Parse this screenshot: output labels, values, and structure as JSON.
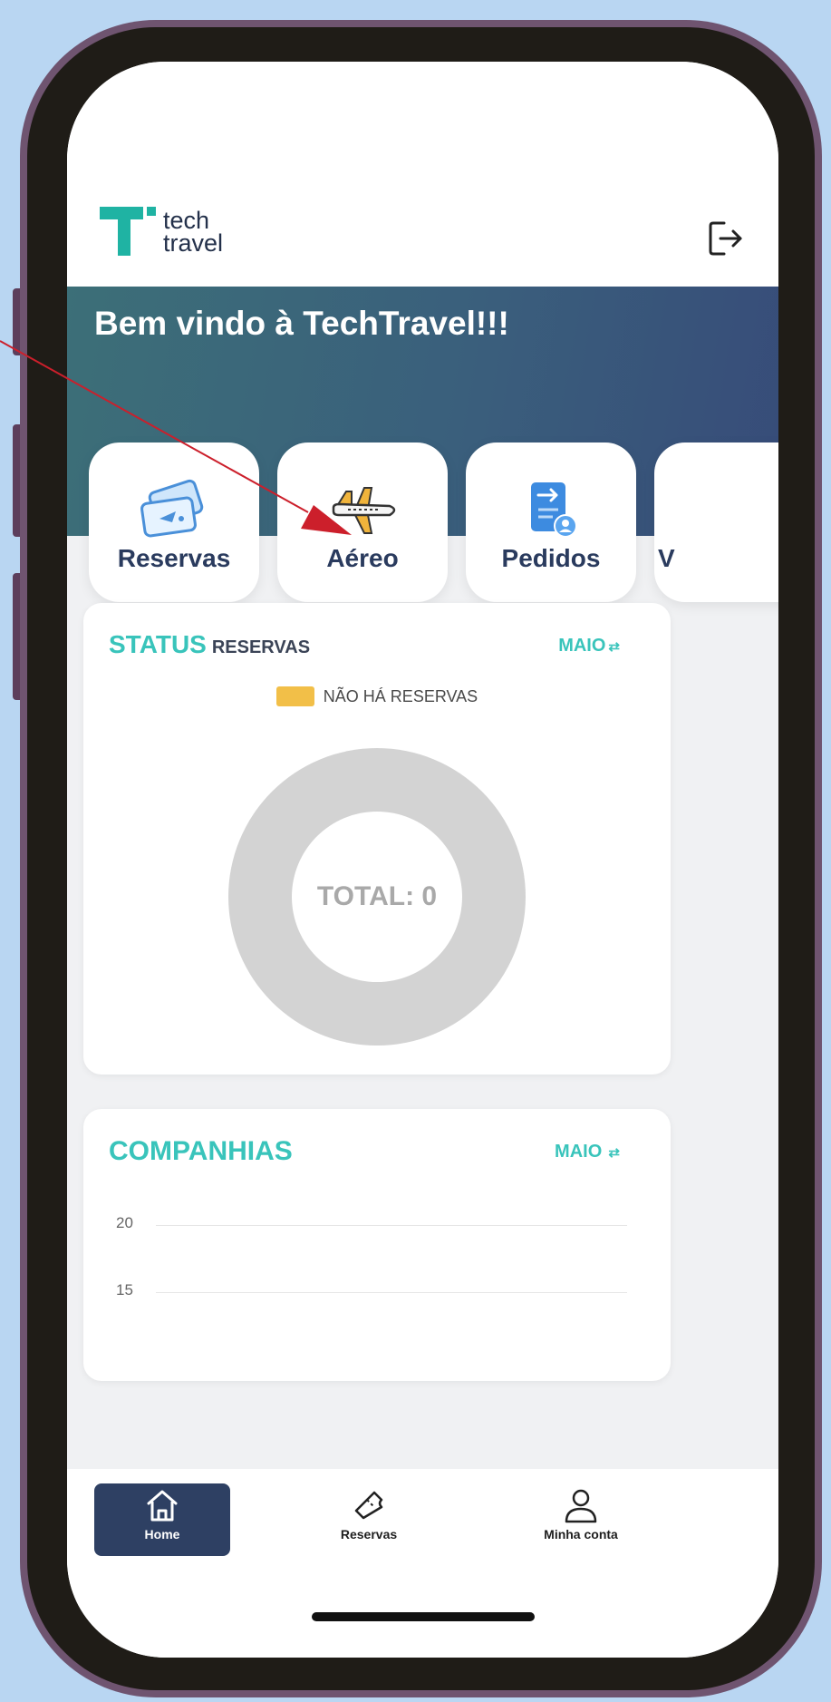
{
  "app": {
    "logo_line1": "tech",
    "logo_line2": "travel",
    "welcome": "Bem vindo à TechTravel!!!"
  },
  "categories": [
    {
      "label": "Reservas",
      "icon": "tickets-icon"
    },
    {
      "label": "Aéreo",
      "icon": "airplane-icon"
    },
    {
      "label": "Pedidos",
      "icon": "document-user-icon"
    },
    {
      "label": "V",
      "icon": ""
    }
  ],
  "status_panel": {
    "title_highlight": "STATUS",
    "title_rest": "RESERVAS",
    "month": "MAIO",
    "legend_label": "NÃO HÁ RESERVAS",
    "legend_color": "#f2bf48",
    "total_label": "TOTAL: 0"
  },
  "companies_panel": {
    "title": "COMPANHIAS",
    "month": "MAIO",
    "y_ticks": [
      "20",
      "15"
    ]
  },
  "bottom_nav": {
    "home": "Home",
    "reservations": "Reservas",
    "account": "Minha conta"
  },
  "colors": {
    "teal": "#39c4bb",
    "navy": "#2e4063",
    "annotation": "#cc1f2b"
  }
}
